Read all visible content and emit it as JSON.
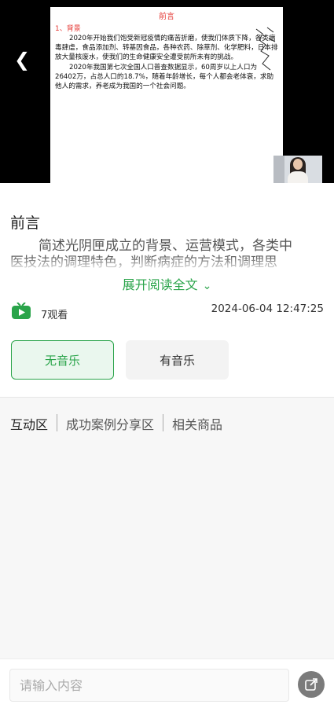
{
  "video": {
    "slide": {
      "title": "前言",
      "heading": "1、背景",
      "paragraph1": "2020年开始我们饱受新冠疫情的痛苦折磨，使我们体质下降，各类病毒肆虐，食品添加剂、转基因食品，各种农药、除草剂、化学肥料，日本排放大量核废水，使我们的生命健康安全遭受前所未有的挑战。",
      "paragraph2": "2020年我国第七次全国人口普查数据显示，60周岁以上人口为26402万，占总人口的18.7%，随着年龄增长，每个人都会老体衰，求助他人的需求，养老成为我国的一个社会问题。"
    }
  },
  "content": {
    "title": "前言",
    "description": "简述光阴匣成立的背景、运营模式，各类中医技法的调理特色，判断病症的方法和调理思路，光阴匣服务类型，学习科目，调理时间等内容。",
    "expand_label": "展开阅读全文",
    "views": "7观看",
    "timestamp": "2024-06-04 12:47:25",
    "buttons": {
      "no_music": "无音乐",
      "with_music": "有音乐"
    }
  },
  "tabs": [
    {
      "label": "互动区"
    },
    {
      "label": "成功案例分享区"
    },
    {
      "label": "相关商品"
    }
  ],
  "bottom": {
    "input_placeholder": "请输入内容"
  },
  "colors": {
    "accent": "#2aa44a",
    "slide_red": "#e53935"
  }
}
